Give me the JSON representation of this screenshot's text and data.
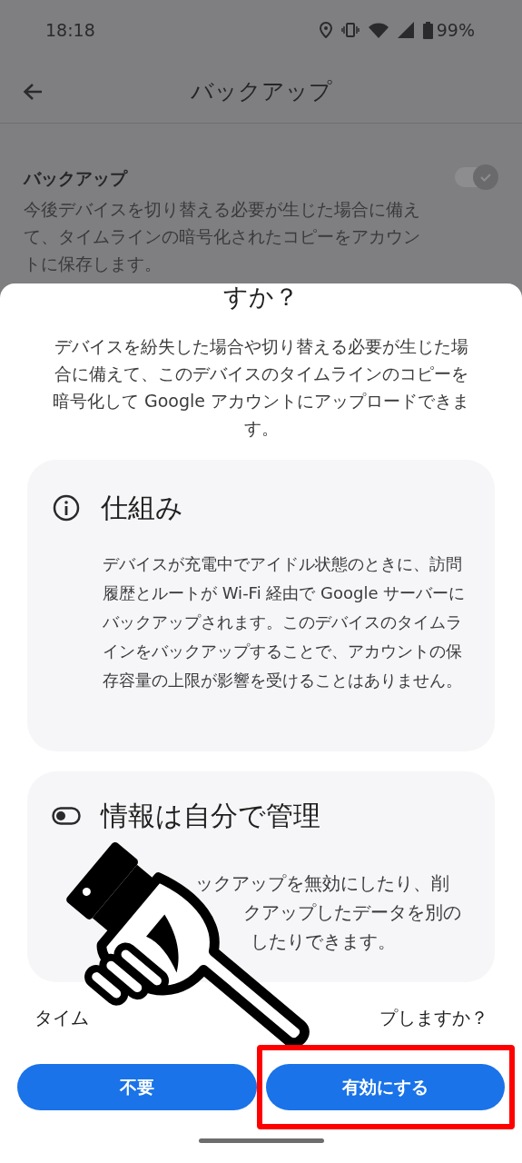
{
  "status_bar": {
    "time": "18:18",
    "battery": "99%"
  },
  "app_bar": {
    "title": "バックアップ"
  },
  "setting": {
    "title": "バックアップ",
    "description": "今後デバイスを切り替える必要が生じた場合に備えて、タイムラインの暗号化されたコピーをアカウントに保存します。",
    "on": true
  },
  "dialog": {
    "title_fragment": "すか？",
    "intro": "デバイスを紛失した場合や切り替える必要が生じた場合に備えて、このデバイスのタイムラインのコピーを暗号化して Google アカウントにアップロードできます。",
    "cards": [
      {
        "kind": "info",
        "title": "仕組み",
        "body": "デバイスが充電中でアイドル状態のときに、訪問履歴とルートが Wi-Fi 経由で Google サーバーにバックアップされます。このデバイスのタイムラインをバックアップすることで、アカウントの保存容量の上限が影響を受けることはありません。"
      },
      {
        "kind": "toggle",
        "title": "情報は自分で管理",
        "visible_lines": [
          "ックアップを無効にしたり、削",
          "クアップしたデータを別の",
          "したりできます。"
        ]
      }
    ],
    "question_fragments": [
      "タイム",
      "プしますか？"
    ],
    "buttons": [
      {
        "label": "不要",
        "highlighted": false
      },
      {
        "label": "有効にする",
        "highlighted": true
      }
    ]
  }
}
